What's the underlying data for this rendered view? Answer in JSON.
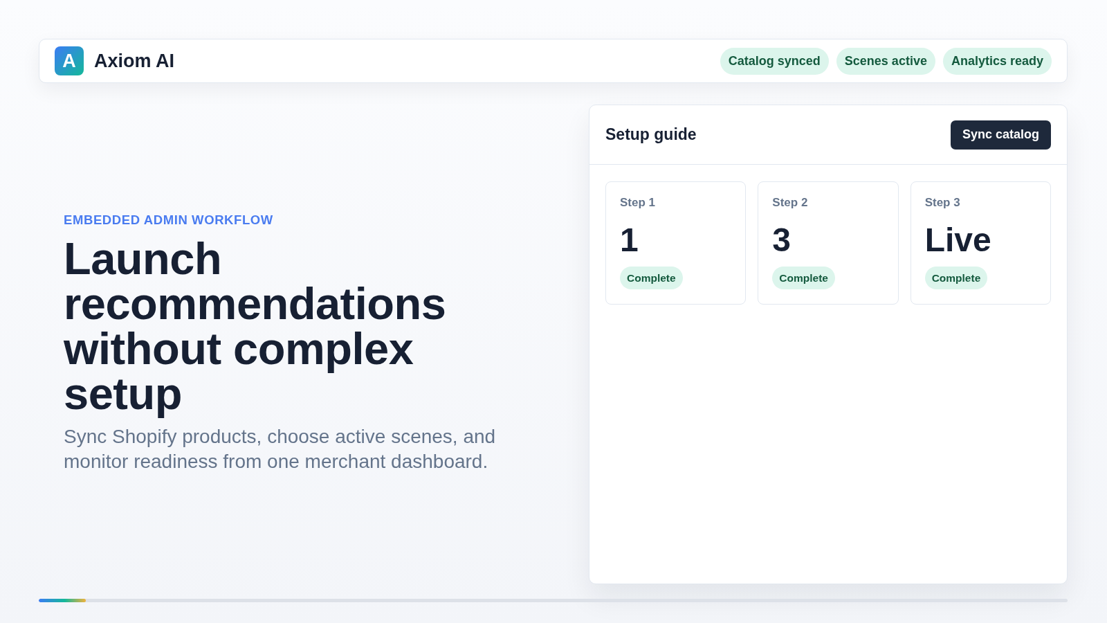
{
  "header": {
    "logo_letter": "A",
    "brand": "Axiom AI",
    "status_pills": [
      "Catalog synced",
      "Scenes active",
      "Analytics ready"
    ]
  },
  "hero": {
    "eyebrow": "EMBEDDED ADMIN WORKFLOW",
    "headline": "Launch recommendations without complex setup",
    "description": "Sync Shopify products, choose active scenes, and monitor readiness from one merchant dashboard."
  },
  "setup_guide": {
    "title": "Setup guide",
    "action": "Sync catalog",
    "steps": [
      {
        "label": "Step 1",
        "value": "1",
        "status": "Complete"
      },
      {
        "label": "Step 2",
        "value": "3",
        "status": "Complete"
      },
      {
        "label": "Step 3",
        "value": "Live",
        "status": "Complete"
      }
    ]
  },
  "progress": {
    "level": 0.046
  }
}
